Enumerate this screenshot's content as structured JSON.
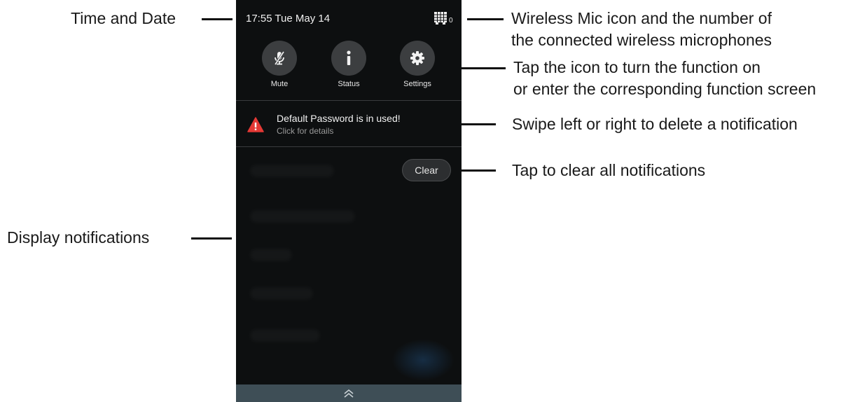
{
  "status_bar": {
    "time_date": "17:55 Tue May 14",
    "mic_count": "0",
    "mic_icon": "wireless-mic-grid-icon"
  },
  "quick_actions": [
    {
      "label": "Mute",
      "icon": "mic-muted-icon"
    },
    {
      "label": "Status",
      "icon": "info-icon"
    },
    {
      "label": "Settings",
      "icon": "gear-icon"
    }
  ],
  "notification": {
    "title": "Default Password is in used!",
    "subtitle": "Click for details",
    "icon": "warning-triangle-icon",
    "icon_color": "#e53935"
  },
  "clear_button": {
    "label": "Clear"
  },
  "bottom_bar": {
    "icon": "double-chevron-up-icon",
    "color": "#3e4e56"
  },
  "callouts": {
    "time_and_date": "Time and Date",
    "wireless_mic_line1": "Wireless Mic icon and the number of",
    "wireless_mic_line2": "the connected wireless microphones",
    "tap_icon_line1": "Tap the icon to turn the function on",
    "tap_icon_line2": "or enter the corresponding function screen",
    "swipe": "Swipe left or right to delete a notification",
    "tap_clear": "Tap to clear all notifications",
    "display_notifications": "Display notifications"
  }
}
